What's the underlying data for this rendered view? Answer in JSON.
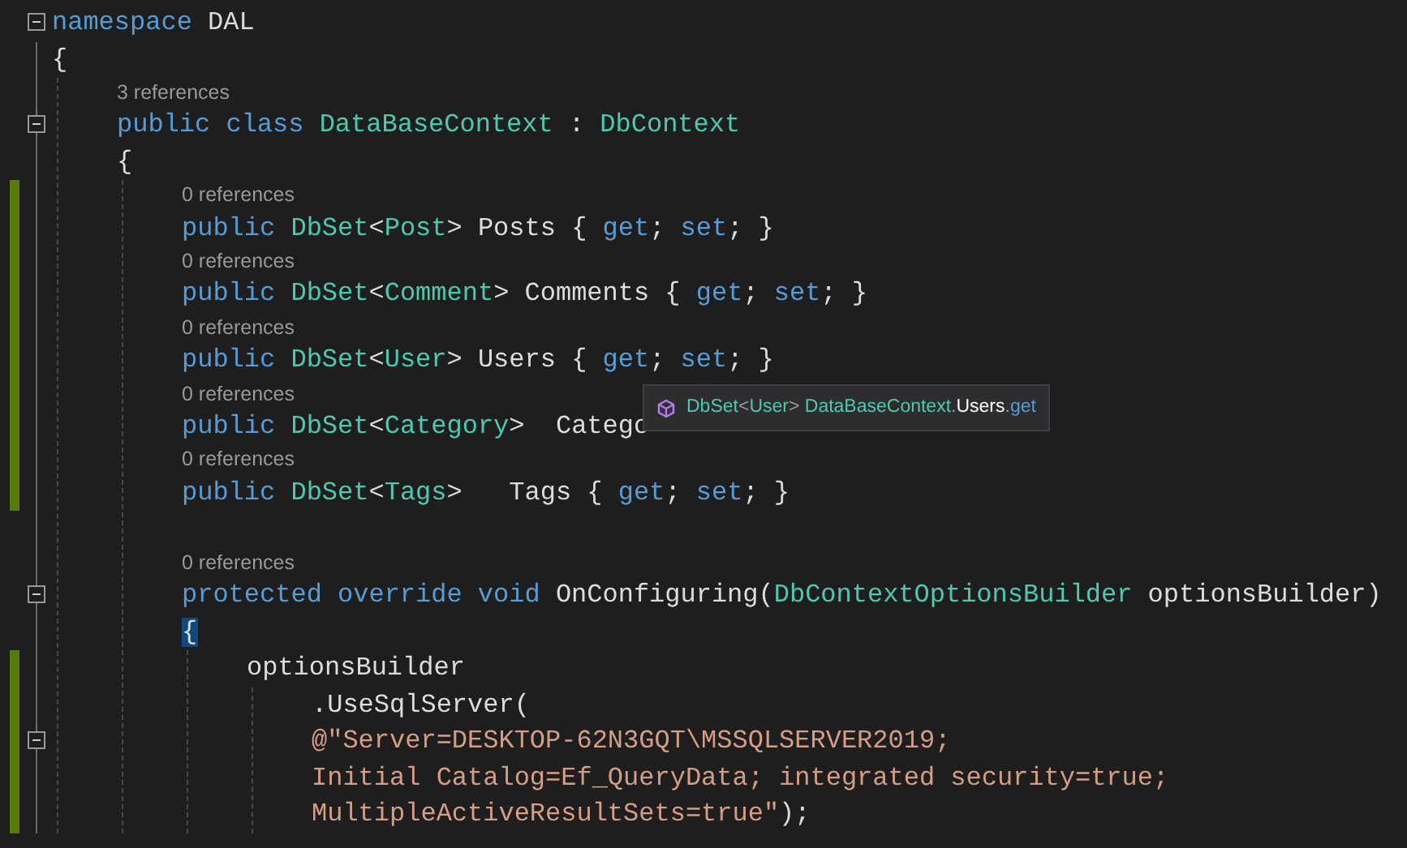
{
  "editor": {
    "lines": [
      {
        "kind": "code",
        "fold": true,
        "changed": false,
        "tokens": [
          {
            "kind": "keyword",
            "text": "namespace"
          },
          {
            "kind": "plain",
            "text": " DAL"
          }
        ]
      },
      {
        "kind": "code",
        "fold": false,
        "changed": false,
        "tokens": [
          {
            "kind": "plain",
            "text": "{"
          }
        ],
        "children": [
          {
            "kind": "lens",
            "changed": false,
            "text": "3 references"
          },
          {
            "kind": "code",
            "fold": true,
            "changed": false,
            "tokens": [
              {
                "kind": "keyword",
                "text": "public class "
              },
              {
                "kind": "type",
                "text": "DataBaseContext"
              },
              {
                "kind": "plain",
                "text": " : "
              },
              {
                "kind": "type",
                "text": "DbContext"
              }
            ]
          },
          {
            "kind": "code",
            "fold": false,
            "changed": false,
            "tokens": [
              {
                "kind": "plain",
                "text": "{"
              }
            ],
            "children": [
              {
                "kind": "lens",
                "changed": true,
                "text": "0 references"
              },
              {
                "kind": "code",
                "fold": false,
                "changed": true,
                "tokens": [
                  {
                    "kind": "keyword",
                    "text": "public "
                  },
                  {
                    "kind": "type",
                    "text": "DbSet"
                  },
                  {
                    "kind": "plain",
                    "text": "<"
                  },
                  {
                    "kind": "type",
                    "text": "Post"
                  },
                  {
                    "kind": "plain",
                    "text": "> Posts { "
                  },
                  {
                    "kind": "keyword",
                    "text": "get"
                  },
                  {
                    "kind": "plain",
                    "text": "; "
                  },
                  {
                    "kind": "keyword",
                    "text": "set"
                  },
                  {
                    "kind": "plain",
                    "text": "; }"
                  }
                ]
              },
              {
                "kind": "lens",
                "changed": true,
                "text": "0 references"
              },
              {
                "kind": "code",
                "fold": false,
                "changed": true,
                "tokens": [
                  {
                    "kind": "keyword",
                    "text": "public "
                  },
                  {
                    "kind": "type",
                    "text": "DbSet"
                  },
                  {
                    "kind": "plain",
                    "text": "<"
                  },
                  {
                    "kind": "type",
                    "text": "Comment"
                  },
                  {
                    "kind": "plain",
                    "text": "> Comments { "
                  },
                  {
                    "kind": "keyword",
                    "text": "get"
                  },
                  {
                    "kind": "plain",
                    "text": "; "
                  },
                  {
                    "kind": "keyword",
                    "text": "set"
                  },
                  {
                    "kind": "plain",
                    "text": "; }"
                  }
                ]
              },
              {
                "kind": "lens",
                "changed": true,
                "text": "0 references"
              },
              {
                "kind": "code",
                "fold": false,
                "changed": true,
                "tokens": [
                  {
                    "kind": "keyword",
                    "text": "public "
                  },
                  {
                    "kind": "type",
                    "text": "DbSet"
                  },
                  {
                    "kind": "plain",
                    "text": "<"
                  },
                  {
                    "kind": "type",
                    "text": "User"
                  },
                  {
                    "kind": "plain",
                    "text": "> Users { "
                  },
                  {
                    "kind": "keyword",
                    "text": "get"
                  },
                  {
                    "kind": "plain",
                    "text": "; "
                  },
                  {
                    "kind": "keyword",
                    "text": "set"
                  },
                  {
                    "kind": "plain",
                    "text": "; }"
                  }
                ]
              },
              {
                "kind": "lens",
                "changed": true,
                "text": "0 references"
              },
              {
                "kind": "code",
                "fold": false,
                "changed": true,
                "tokens": [
                  {
                    "kind": "keyword",
                    "text": "public "
                  },
                  {
                    "kind": "type",
                    "text": "DbSet"
                  },
                  {
                    "kind": "plain",
                    "text": "<"
                  },
                  {
                    "kind": "type",
                    "text": "Category"
                  },
                  {
                    "kind": "plain",
                    "text": ">  Catego"
                  }
                ]
              },
              {
                "kind": "lens",
                "changed": true,
                "text": "0 references"
              },
              {
                "kind": "code",
                "fold": false,
                "changed": true,
                "tokens": [
                  {
                    "kind": "keyword",
                    "text": "public "
                  },
                  {
                    "kind": "type",
                    "text": "DbSet"
                  },
                  {
                    "kind": "plain",
                    "text": "<"
                  },
                  {
                    "kind": "type",
                    "text": "Tags"
                  },
                  {
                    "kind": "plain",
                    "text": ">   Tags { "
                  },
                  {
                    "kind": "keyword",
                    "text": "get"
                  },
                  {
                    "kind": "plain",
                    "text": "; "
                  },
                  {
                    "kind": "keyword",
                    "text": "set"
                  },
                  {
                    "kind": "plain",
                    "text": "; }"
                  }
                ]
              },
              {
                "kind": "blank",
                "changed": false
              },
              {
                "kind": "lens",
                "changed": false,
                "text": "0 references"
              },
              {
                "kind": "code",
                "fold": true,
                "changed": false,
                "tokens": [
                  {
                    "kind": "keyword",
                    "text": "protected override void "
                  },
                  {
                    "kind": "plain",
                    "text": "OnConfiguring("
                  },
                  {
                    "kind": "type",
                    "text": "DbContextOptionsBuilder"
                  },
                  {
                    "kind": "plain",
                    "text": " optionsBuilder)"
                  }
                ]
              },
              {
                "kind": "code",
                "fold": false,
                "changed": false,
                "tokens": [
                  {
                    "kind": "brace-match",
                    "text": "{"
                  }
                ],
                "children": [
                  {
                    "kind": "code",
                    "fold": false,
                    "changed": true,
                    "tokens": [
                      {
                        "kind": "plain",
                        "text": "optionsBuilder"
                      }
                    ],
                    "children": [
                      {
                        "kind": "code",
                        "fold": false,
                        "changed": true,
                        "tokens": [
                          {
                            "kind": "plain",
                            "text": ".UseSqlServer("
                          }
                        ]
                      },
                      {
                        "kind": "code",
                        "fold": true,
                        "changed": true,
                        "tokens": [
                          {
                            "kind": "string",
                            "text": "@\"Server=DESKTOP-62N3GQT\\MSSQLSERVER2019;"
                          }
                        ]
                      },
                      {
                        "kind": "code",
                        "fold": false,
                        "changed": true,
                        "tokens": [
                          {
                            "kind": "string",
                            "text": "Initial Catalog=Ef_QueryData; integrated security=true;"
                          }
                        ]
                      },
                      {
                        "kind": "code",
                        "fold": false,
                        "changed": true,
                        "tokens": [
                          {
                            "kind": "string",
                            "text": "MultipleActiveResultSets=true\""
                          },
                          {
                            "kind": "plain",
                            "text": ");"
                          }
                        ]
                      }
                    ]
                  }
                ]
              }
            ]
          }
        ]
      }
    ]
  },
  "tooltip": {
    "tokens": [
      {
        "kind": "type",
        "text": "DbSet"
      },
      {
        "kind": "punct",
        "text": "<"
      },
      {
        "kind": "type",
        "text": "User"
      },
      {
        "kind": "punct",
        "text": ">"
      },
      {
        "kind": "type",
        "text": " DataBaseContext"
      },
      {
        "kind": "punct",
        "text": "."
      },
      {
        "kind": "plain",
        "text": "Users"
      },
      {
        "kind": "punct",
        "text": "."
      },
      {
        "kind": "keyword",
        "text": "get"
      }
    ]
  }
}
